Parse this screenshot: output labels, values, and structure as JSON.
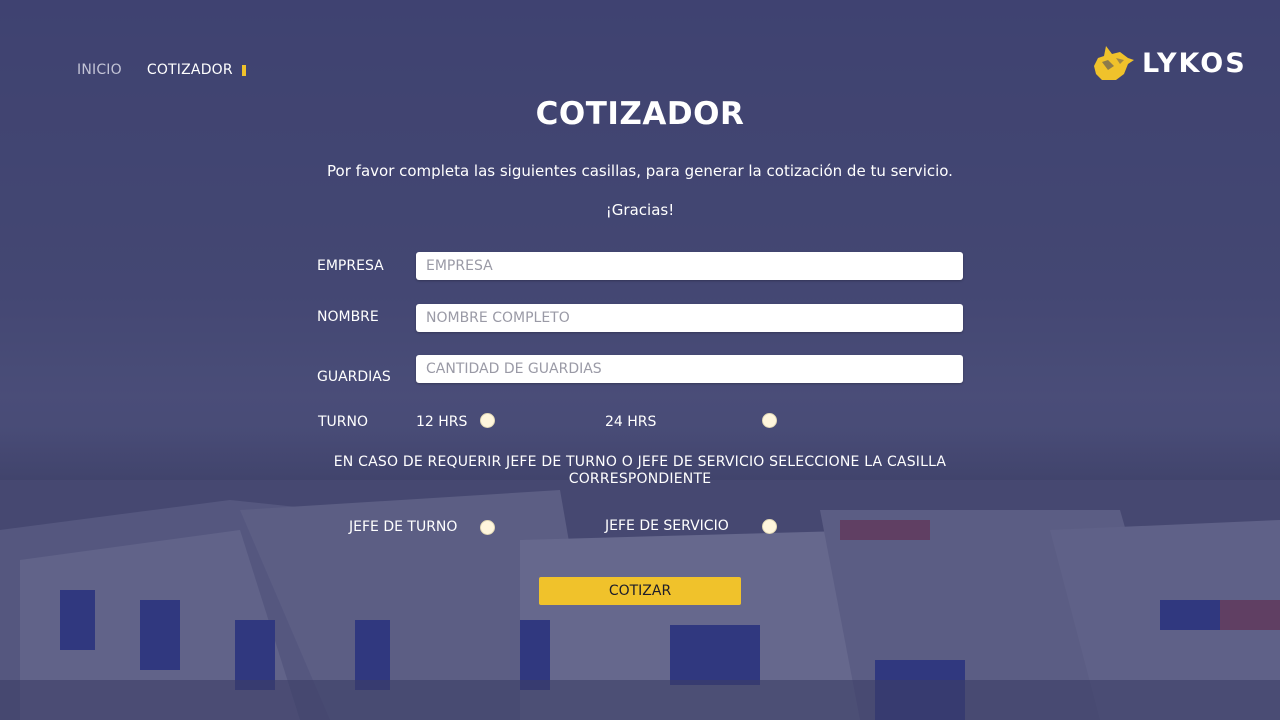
{
  "nav": {
    "items": [
      {
        "label": "INICIO"
      },
      {
        "label": "COTIZADOR"
      }
    ]
  },
  "brand": {
    "name": "LYKOS",
    "accent_color": "#f0c22b",
    "icon": "wolf-head-logo"
  },
  "page": {
    "title": "COTIZADOR",
    "intro": "Por favor completa las siguientes casillas, para generar la cotización de tu servicio.",
    "thanks": "¡Gracias!"
  },
  "form": {
    "empresa": {
      "label": "EMPRESA",
      "placeholder": "EMPRESA",
      "value": ""
    },
    "nombre": {
      "label": "NOMBRE",
      "placeholder": "NOMBRE COMPLETO",
      "value": ""
    },
    "guardias": {
      "label": "GUARDIAS",
      "placeholder": "CANTIDAD DE GUARDIAS",
      "value": ""
    },
    "turno": {
      "label": "TURNO",
      "options": [
        {
          "label": "12 HRS",
          "selected": false
        },
        {
          "label": "24 HRS",
          "selected": false
        }
      ]
    },
    "notice": "EN CASO DE REQUERIR JEFE DE TURNO O JEFE DE SERVICIO SELECCIONE LA CASILLA CORRESPONDIENTE",
    "jefes": [
      {
        "label": "JEFE DE TURNO",
        "selected": false
      },
      {
        "label": "JEFE DE SERVICIO",
        "selected": false
      }
    ],
    "submit_label": "COTIZAR"
  },
  "colors": {
    "overlay": "#2a2c64",
    "button": "#f0c22b",
    "nav_marker": "#f0c22b"
  }
}
